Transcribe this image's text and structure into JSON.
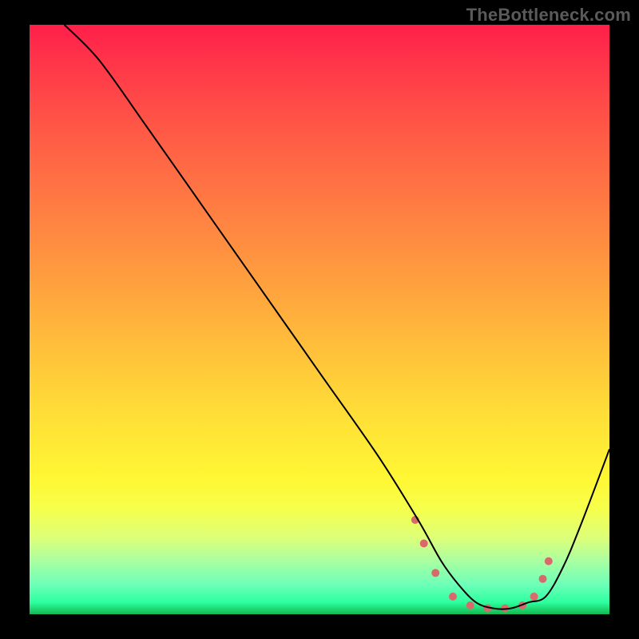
{
  "watermark": "TheBottleneck.com",
  "chart_data": {
    "type": "line",
    "title": "",
    "xlabel": "",
    "ylabel": "",
    "xlim": [
      0,
      100
    ],
    "ylim": [
      0,
      100
    ],
    "grid": false,
    "legend": false,
    "background": "rainbow-vertical-gradient",
    "series": [
      {
        "name": "curve",
        "x": [
          6,
          12,
          20,
          30,
          40,
          50,
          60,
          67,
          71,
          74,
          77,
          80,
          83,
          86,
          89,
          92,
          95,
          100
        ],
        "y": [
          100,
          94,
          83,
          69,
          55,
          41,
          27,
          16,
          9,
          5,
          2,
          1,
          1,
          2,
          3,
          8,
          15,
          28
        ]
      }
    ],
    "markers": {
      "name": "highlight-points",
      "color": "#d86a6c",
      "radius": 5,
      "x": [
        66.5,
        68,
        70,
        73,
        76,
        79,
        82,
        85,
        87,
        88.5,
        89.5
      ],
      "y": [
        16,
        12,
        7,
        3,
        1.5,
        1,
        1,
        1.5,
        3,
        6,
        9
      ]
    }
  }
}
